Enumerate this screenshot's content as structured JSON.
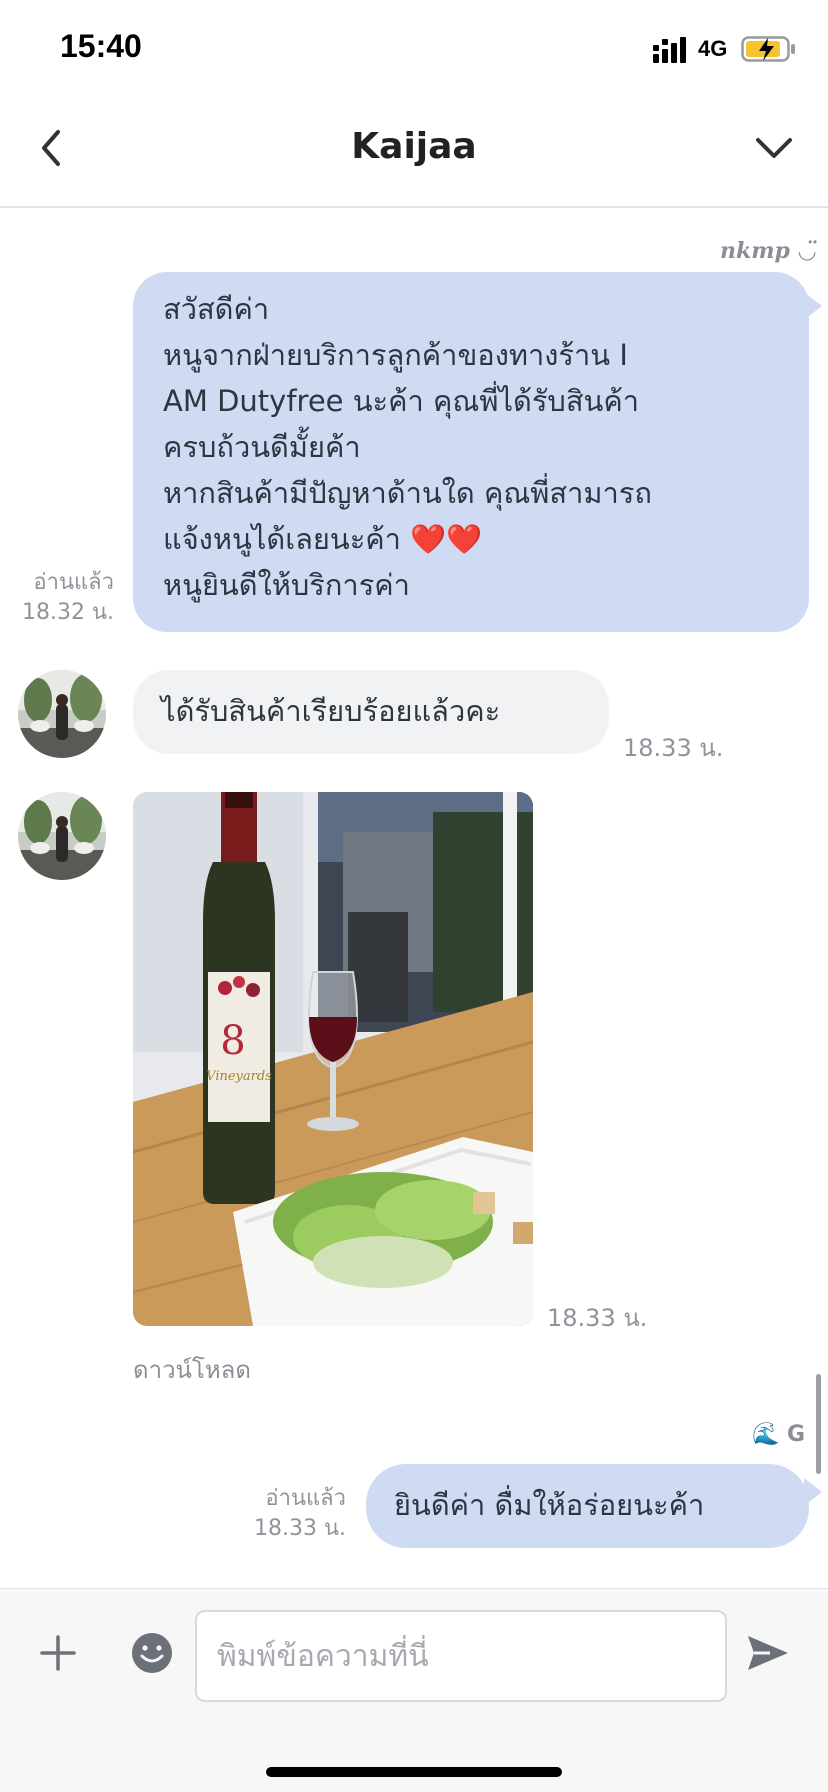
{
  "status_bar": {
    "time": "15:40",
    "network": "4G",
    "icons": [
      "signal-icon",
      "battery-charging-icon"
    ]
  },
  "header": {
    "title": "Kaijaa",
    "icons": [
      "back-chevron-icon",
      "menu-chevron-down-icon"
    ]
  },
  "messages": [
    {
      "direction": "outgoing",
      "sender_tag": "nkmp ◡̈",
      "text": "สวัสดีค่า\nหนูจากฝ่ายบริการลูกค้าของทางร้าน I\nAM Dutyfree นะค้า คุณพี่ได้รับสินค้า\nครบถ้วนดีมั้ยค้า\nหากสินค้ามีปัญหาด้านใด คุณพี่สามารถ\nแจ้งหนูได้เลยนะค้า ❤️❤️\nหนูยินดีให้บริการค่า",
      "read_label": "อ่านแล้ว",
      "time": "18.32 น."
    },
    {
      "direction": "incoming",
      "text": "ได้รับสินค้าเรียบร้อยแล้วคะ",
      "time": "18.33 น."
    },
    {
      "direction": "incoming",
      "type": "image",
      "image_description": "wine-bottle-and-salad-photo",
      "bottle_label": "8",
      "bottle_brand": "Vineyards",
      "time": "18.33 น.",
      "download_label": "ดาวน์โหลด"
    },
    {
      "direction": "outgoing",
      "sender_tag": "🌊 G",
      "text": "ยินดีค่า ดื่มให้อร่อยนะค้า",
      "read_label": "อ่านแล้ว",
      "time": "18.33 น."
    }
  ],
  "composer": {
    "placeholder": "พิมพ์ข้อความที่นี่",
    "value": "",
    "icons": [
      "plus-icon",
      "emoji-icon",
      "send-icon"
    ]
  },
  "colors": {
    "outgoing_bubble": "#cfdaf3",
    "incoming_bubble": "#f1f2f4",
    "meta_text": "#8f939a"
  }
}
